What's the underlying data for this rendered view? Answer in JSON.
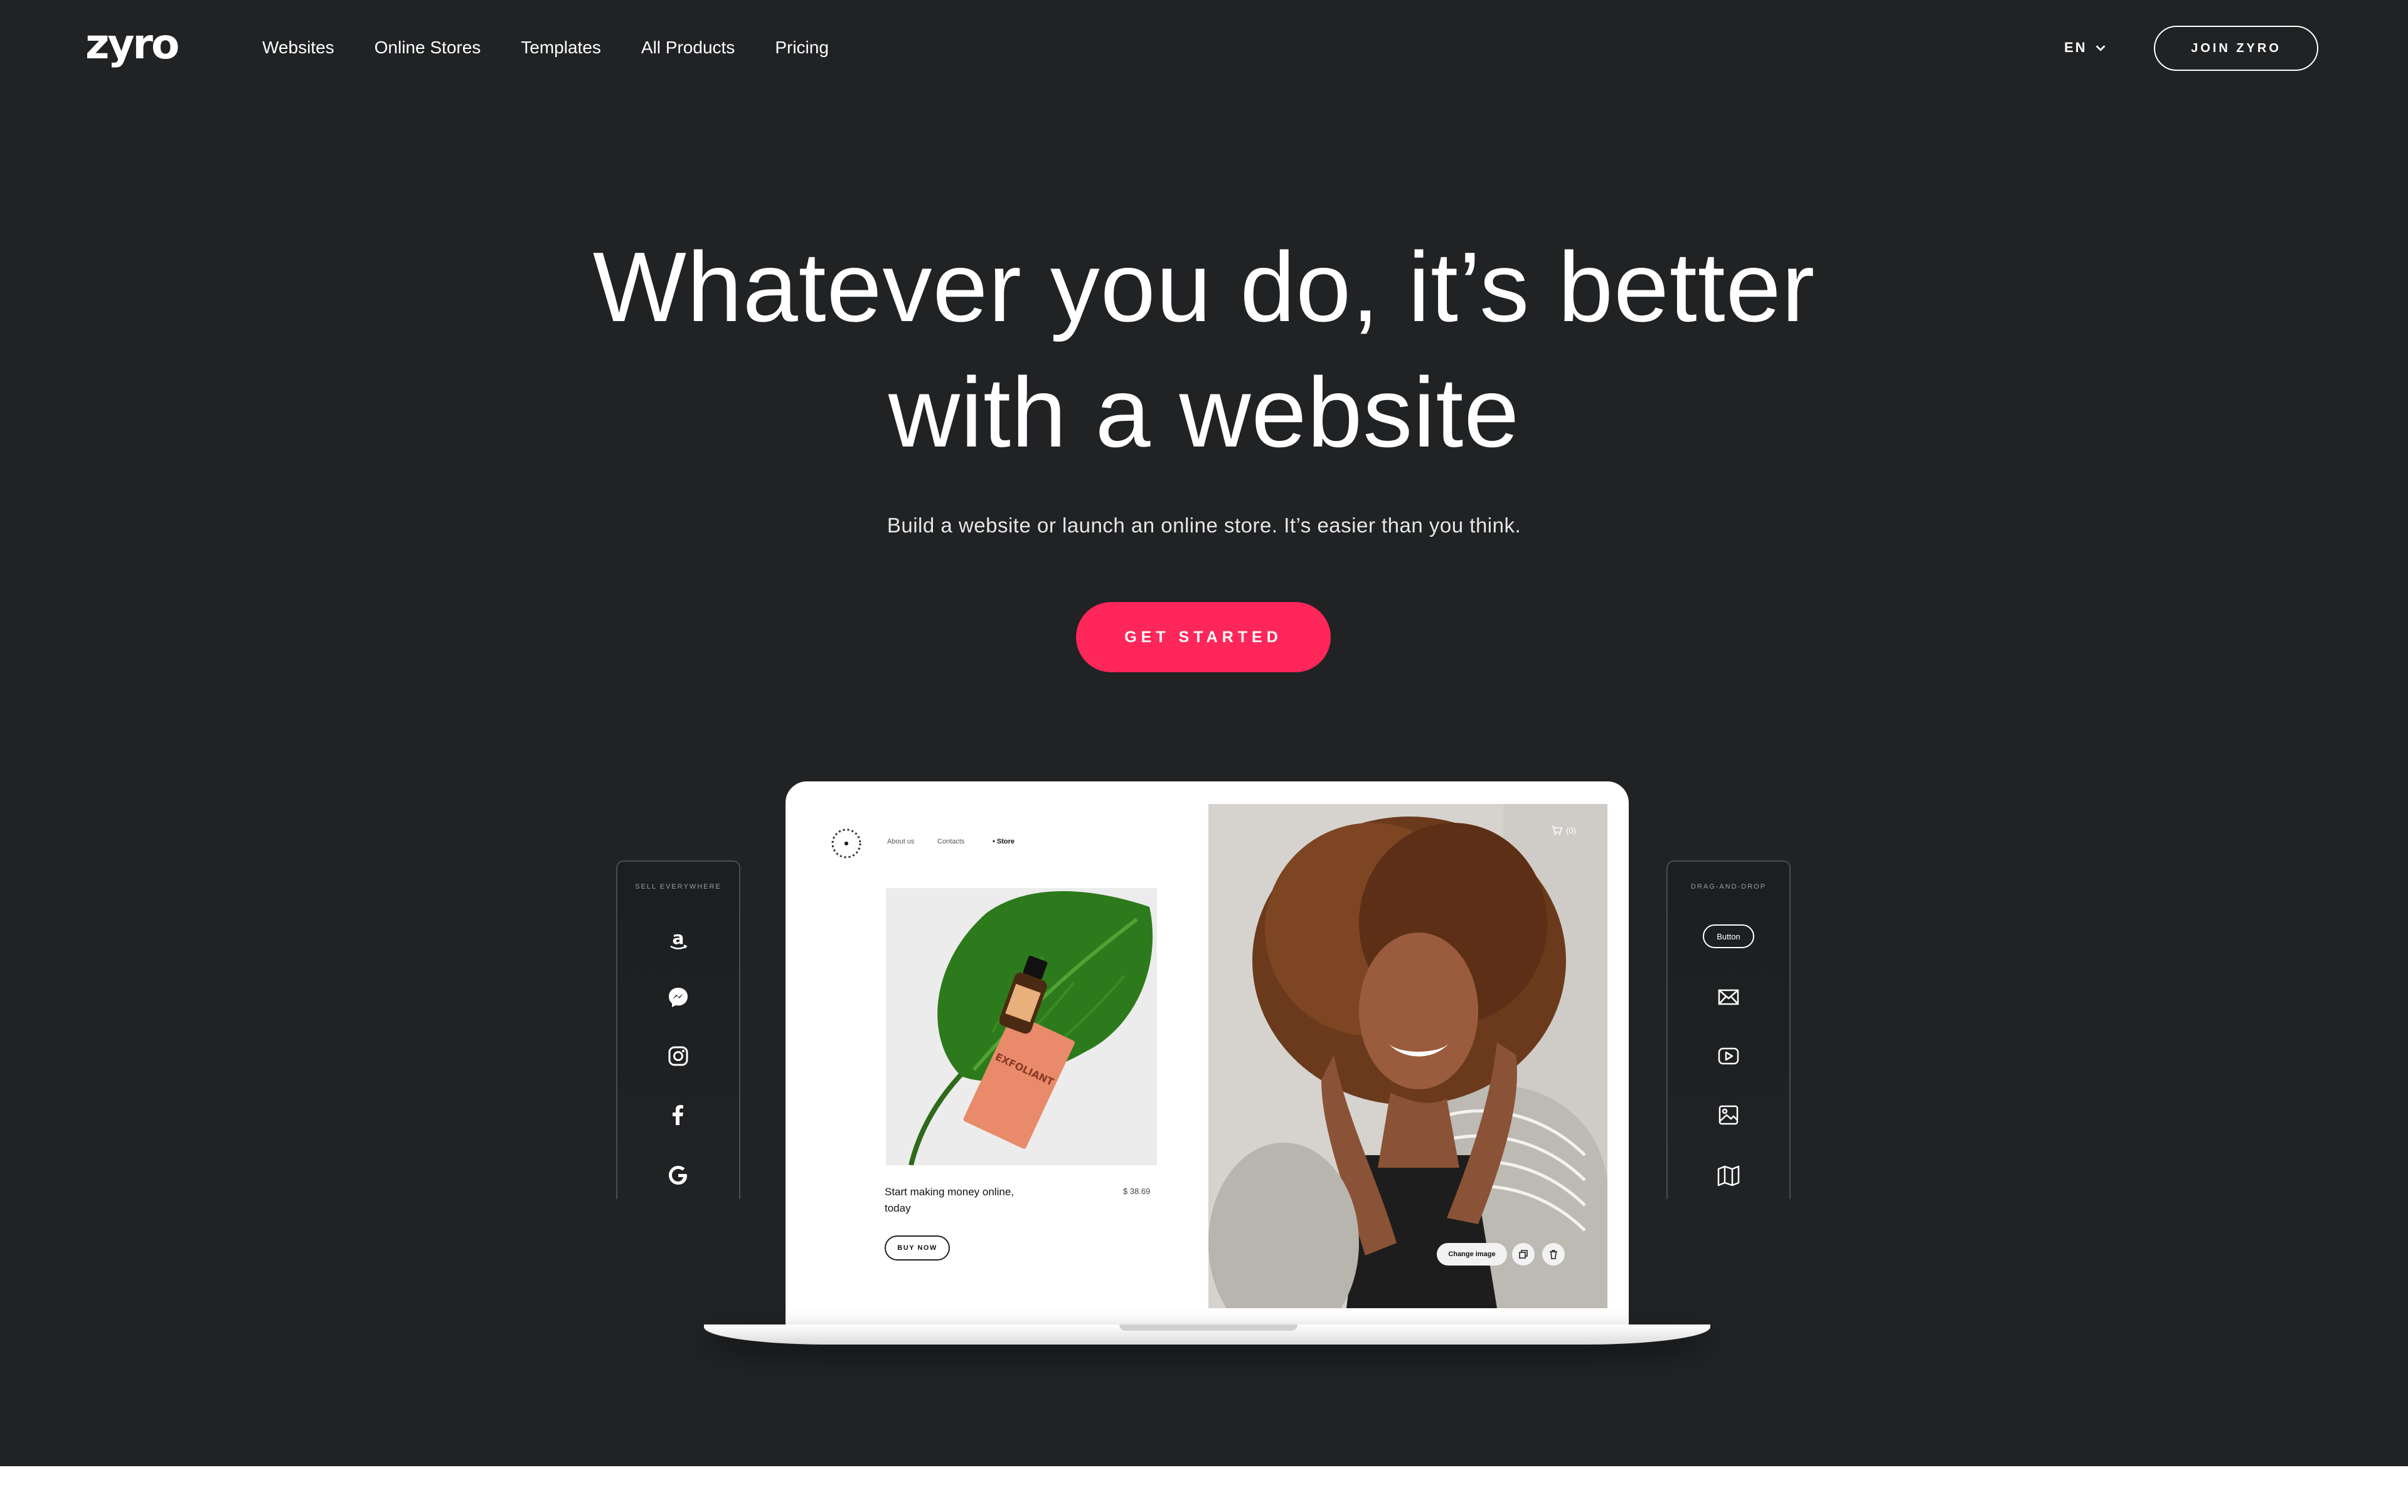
{
  "header": {
    "logo": "zyro",
    "nav": [
      "Websites",
      "Online Stores",
      "Templates",
      "All Products",
      "Pricing"
    ],
    "language": "EN",
    "join_label": "JOIN ZYRO"
  },
  "hero": {
    "headline_line1": "Whatever you do, it’s better",
    "headline_line2": "with a website",
    "subtitle": "Build a website or launch an online store. It’s easier than you think.",
    "cta_label": "GET STARTED"
  },
  "left_panel": {
    "title": "SELL EVERYWHERE",
    "icons": [
      "amazon-icon",
      "messenger-icon",
      "instagram-icon",
      "facebook-icon",
      "google-icon"
    ]
  },
  "right_panel": {
    "title": "DRAG-AND-DROP",
    "button_label": "Button",
    "icons": [
      "mail-icon",
      "video-icon",
      "image-icon",
      "map-icon"
    ]
  },
  "mockup": {
    "nav": [
      "About us",
      "Contacts",
      "Store"
    ],
    "product_title": "Start making money online, today",
    "price": "$ 38.69",
    "buy_label": "BUY NOW",
    "cart_count": "(0)",
    "change_image_label": "Change image"
  },
  "colors": {
    "background": "#202224",
    "accent": "#ff2659"
  }
}
